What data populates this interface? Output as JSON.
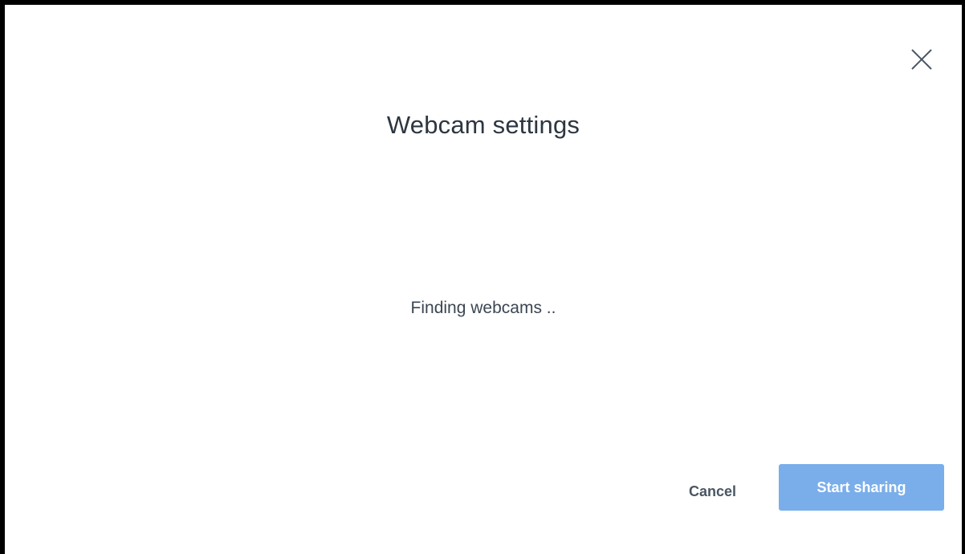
{
  "dialog": {
    "title": "Webcam settings",
    "status_text": "Finding webcams ..",
    "close_icon": "close-icon"
  },
  "actions": {
    "cancel_label": "Cancel",
    "start_label": "Start sharing",
    "start_color": "#7aaeea"
  }
}
